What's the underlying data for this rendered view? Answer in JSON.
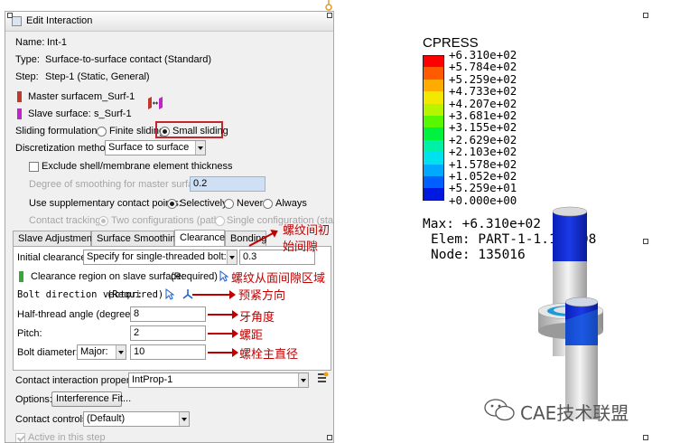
{
  "dialog": {
    "title": "Edit Interaction",
    "name_label": "Name:",
    "name_value": "Int-1",
    "type_label": "Type:",
    "type_value": "Surface-to-surface contact (Standard)",
    "step_label": "Step:",
    "step_value": "Step-1 (Static, General)",
    "master_label": "Master surface:",
    "master_value": "m_Surf-1",
    "slave_label": "Slave surface:",
    "slave_value": "s_Surf-1",
    "sliding_label": "Sliding formulation:",
    "sliding_options": [
      "Finite sliding",
      "Small sliding"
    ],
    "sliding_selected": "Small sliding",
    "discretization_label": "Discretization method:",
    "discretization_value": "Surface to surface",
    "exclude_label": "Exclude shell/membrane element thickness",
    "smoothing_label": "Degree of smoothing for master surface:",
    "smoothing_value": "0.2",
    "supplementary_label": "Use supplementary contact points:",
    "supplementary_options": [
      "Selectively",
      "Never",
      "Always"
    ],
    "supplementary_selected": "Selectively",
    "tracking_label": "Contact tracking:",
    "tracking_options": [
      "Two configurations (path)",
      "Single configuration (state)"
    ],
    "tabs": [
      "Slave Adjustment",
      "Surface Smoothing",
      "Clearance",
      "Bonding"
    ],
    "active_tab": "Clearance",
    "clearance": {
      "initial_label": "Initial clearance:",
      "initial_mode": "Specify for single-threaded bolt:",
      "initial_value": "0.3",
      "region_label": "Clearance region on slave surface:",
      "region_status": "(Required)",
      "bolt_dir_label": "Bolt direction vector:",
      "bolt_dir_status": "(Required)",
      "half_angle_label": "Half-thread angle (degrees):",
      "half_angle_value": "8",
      "pitch_label": "Pitch:",
      "pitch_value": "2",
      "diameter_label": "Bolt diameter:",
      "diameter_mode": "Major:",
      "diameter_value": "10"
    },
    "property_label": "Contact interaction property:",
    "property_value": "IntProp-1",
    "options_label": "Options:",
    "options_button": "Interference Fit...",
    "controls_label": "Contact controls:",
    "controls_value": "(Default)",
    "active_label": "Active in this step"
  },
  "annotations": {
    "initial": "螺纹间初始间隙",
    "region": "螺纹从面间隙区域",
    "direction": "预紧方向",
    "angle": "牙角度",
    "pitch": "螺距",
    "diameter": "螺栓主直径"
  },
  "legend": {
    "title": "CPRESS",
    "values": [
      "+6.310e+02",
      "+5.784e+02",
      "+5.259e+02",
      "+4.733e+02",
      "+4.207e+02",
      "+3.681e+02",
      "+3.155e+02",
      "+2.629e+02",
      "+2.103e+02",
      "+1.578e+02",
      "+1.052e+02",
      "+5.259e+01",
      "+0.000e+00"
    ],
    "colors": [
      "#ff0000",
      "#ff5a00",
      "#ffab00",
      "#f3e900",
      "#b6f400",
      "#57f700",
      "#00f23f",
      "#00f0a6",
      "#00e1ee",
      "#00a8ff",
      "#0060ff",
      "#0019e0"
    ],
    "max_line": "Max: +6.310e+02",
    "elem_line": "Elem: PART-1-1.108108",
    "node_line": "Node: 135016"
  },
  "watermark": "CAE技术联盟"
}
